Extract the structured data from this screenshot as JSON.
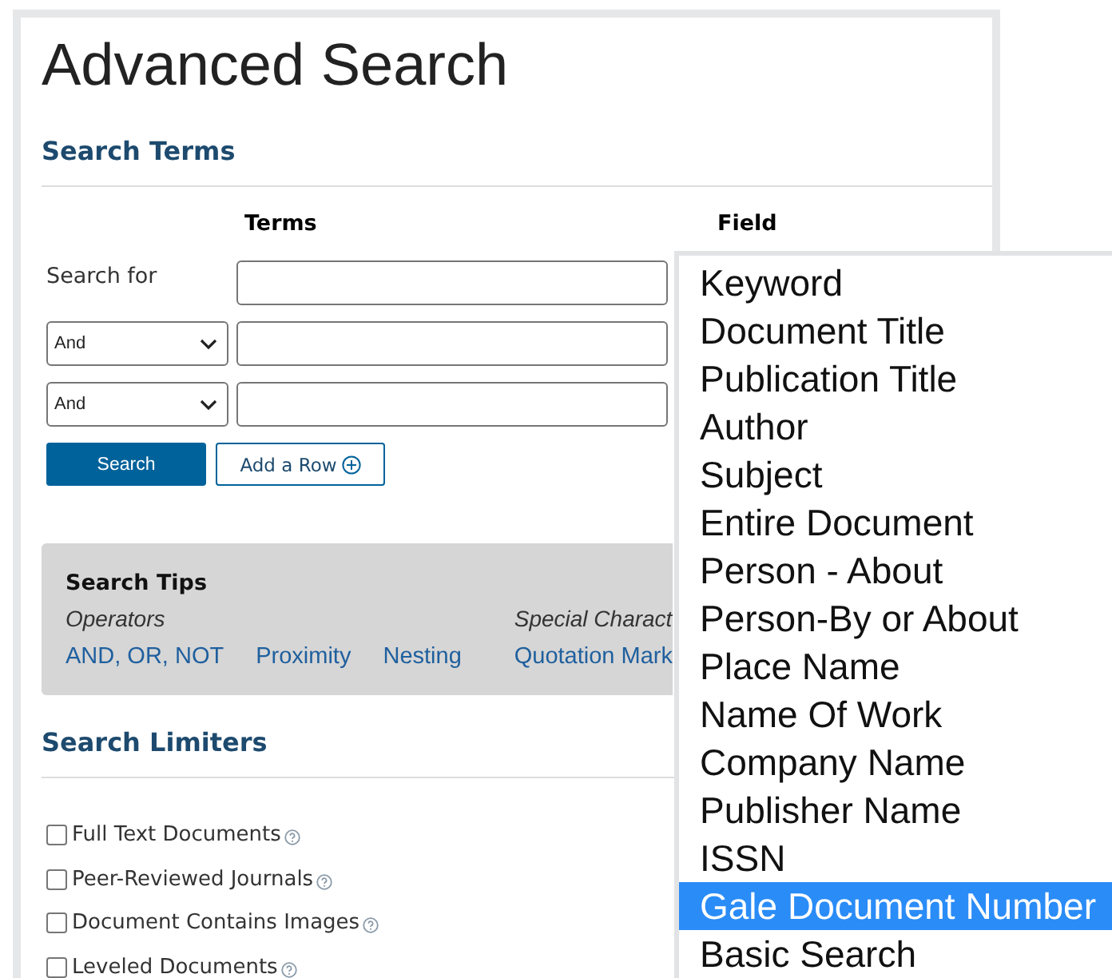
{
  "title": "Advanced Search",
  "search_terms": {
    "heading": "Search Terms",
    "columns": [
      "Terms",
      "Field"
    ],
    "rows": [
      {
        "kind": "label",
        "label": "Search for"
      },
      {
        "kind": "operator",
        "operator": "And"
      },
      {
        "kind": "operator",
        "operator": "And"
      }
    ],
    "buttons": {
      "search": "Search",
      "add_row": "Add a Row"
    }
  },
  "search_tips": {
    "heading": "Search Tips",
    "groups": [
      {
        "title": "Operators",
        "links": [
          "AND, OR, NOT",
          "Proximity",
          "Nesting"
        ]
      },
      {
        "title": "Special Charact",
        "links": [
          "Quotation Mark"
        ]
      }
    ]
  },
  "search_limiters": {
    "heading": "Search Limiters",
    "options": [
      {
        "label": "Full Text Documents",
        "checked": false
      },
      {
        "label": "Peer-Reviewed Journals",
        "checked": false
      },
      {
        "label": "Document Contains Images",
        "checked": false
      },
      {
        "label": "Leveled Documents",
        "checked": false
      }
    ]
  },
  "field_dropdown": {
    "options": [
      {
        "label": "Keyword",
        "selected": false
      },
      {
        "label": "Document Title",
        "selected": false
      },
      {
        "label": "Publication Title",
        "selected": false
      },
      {
        "label": "Author",
        "selected": false
      },
      {
        "label": "Subject",
        "selected": false
      },
      {
        "label": "Entire Document",
        "selected": false
      },
      {
        "label": "Person - About",
        "selected": false
      },
      {
        "label": "Person-By or About",
        "selected": false
      },
      {
        "label": "Place Name",
        "selected": false
      },
      {
        "label": "Name Of Work",
        "selected": false
      },
      {
        "label": "Company Name",
        "selected": false
      },
      {
        "label": "Publisher Name",
        "selected": false
      },
      {
        "label": "ISSN",
        "selected": false
      },
      {
        "label": "Gale Document Number",
        "selected": true
      },
      {
        "label": "Basic Search",
        "selected": false
      }
    ]
  }
}
